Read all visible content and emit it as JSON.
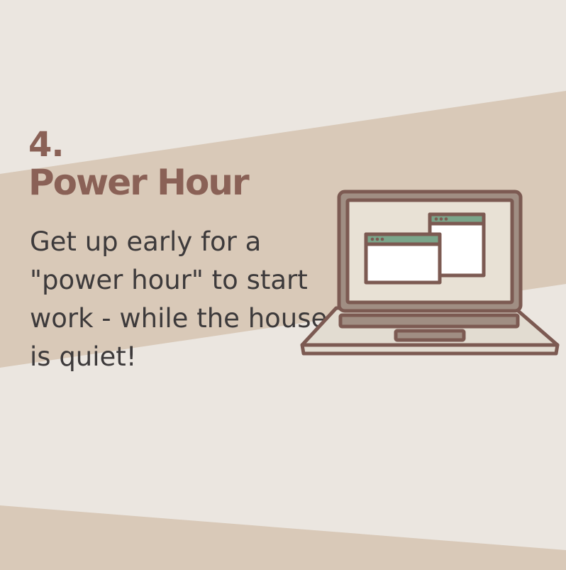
{
  "slide": {
    "number": "4.",
    "title": "Power Hour",
    "body": "Get up early for a \"power hour\" to start work - while the house is quiet!"
  },
  "colors": {
    "background": "#ebe6e0",
    "band": "#d9c9b8",
    "accent": "#8a6156",
    "text": "#3d3a3b",
    "window_bar": "#7aa58a"
  },
  "illustration": {
    "icon": "laptop-icon"
  }
}
